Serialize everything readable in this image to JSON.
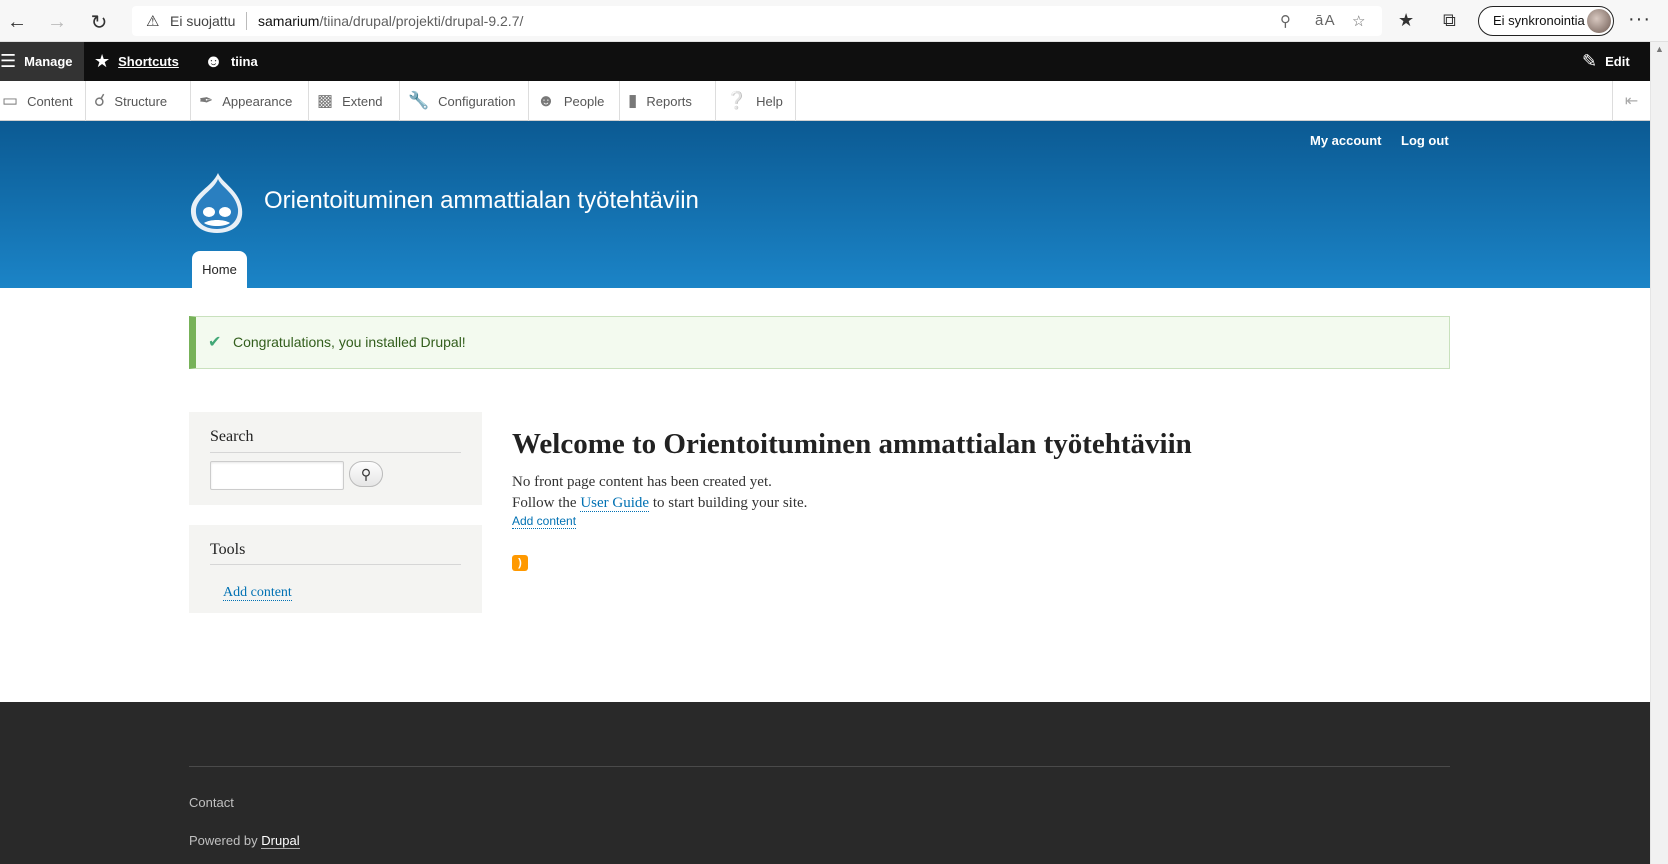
{
  "browser": {
    "security_label": "Ei suojattu",
    "url_host": "samarium",
    "url_path": "/tiina/drupal/projekti/drupal-9.2.7/",
    "profile_label": "Ei synkronointia",
    "more_label": "···"
  },
  "toolbar": {
    "manage_label": "Manage",
    "shortcuts_label": "Shortcuts",
    "user_label": "tiina",
    "edit_label": "Edit",
    "tray_items": [
      "Content",
      "Structure",
      "Appearance",
      "Extend",
      "Configuration",
      "People",
      "Reports",
      "Help"
    ]
  },
  "header": {
    "secondary_menu": [
      "My account",
      "Log out"
    ],
    "site_name": "Orientoituminen ammattialan työtehtäviin",
    "tab_home": "Home"
  },
  "status": {
    "message": "Congratulations, you installed Drupal!"
  },
  "sidebar": {
    "search_title": "Search",
    "tools_title": "Tools",
    "tools_link": "Add content"
  },
  "main": {
    "title": "Welcome to Orientoituminen ammattialan työtehtäviin",
    "line1": "No front page content has been created yet.",
    "line2_before": "Follow the",
    "line2_link": "User Guide",
    "line2_after": "to start building your site.",
    "add_content": "Add content"
  },
  "footer": {
    "contact": "Contact",
    "powered_by": "Powered by",
    "drupal_link": "Drupal"
  },
  "colors": {
    "header_top": "#0b5a93",
    "header_bottom": "#1b84c7",
    "link": "#0071b3",
    "status_accent": "#77b259",
    "footer_bg": "#292929"
  }
}
